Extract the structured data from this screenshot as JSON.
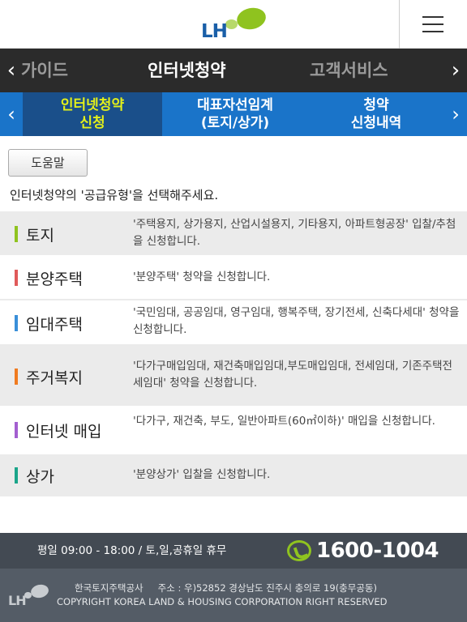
{
  "header": {
    "logo_text": "LH"
  },
  "topnav": {
    "prev": "가이드",
    "current": "인터넷청약",
    "next": "고객서비스",
    "arrow_left": "‹",
    "arrow_right": "›"
  },
  "subnav": {
    "tabs": [
      {
        "line1": "인터넷청약",
        "line2": "신청"
      },
      {
        "line1": "대표자선임계",
        "line2": "(토지/상가)"
      },
      {
        "line1": "청약",
        "line2": "신청내역"
      }
    ],
    "arrow_left": "‹",
    "arrow_right": "›"
  },
  "help_label": "도움말",
  "instruction": "인터넷청약의 '공급유형'을 선택해주세요.",
  "supply_types": [
    {
      "title": "토지",
      "desc": "'주택용지, 상가용지, 산업시설용지, 기타용지, 아파트형공장' 입찰/추첨을 신청합니다.",
      "color": "#8fc31f"
    },
    {
      "title": "분양주택",
      "desc": "'분양주택' 청약을 신청합니다.",
      "color": "#e05a5a"
    },
    {
      "title": "임대주택",
      "desc": "'국민임대, 공공임대, 영구임대, 행복주택, 장기전세, 신축다세대' 청약을 신청합니다.",
      "color": "#3a8fd9"
    },
    {
      "title": "주거복지",
      "desc": "'다가구매입임대, 재건축매입임대,부도매입임대, 전세임대, 기존주택전세임대' 청약을 신청합니다.",
      "color": "#f07b20"
    },
    {
      "title": "인터넷 매입",
      "desc": "'다가구, 재건축, 부도, 일반아파트(60㎡이하)' 매입을 신청합니다.",
      "color": "#a35fd0"
    },
    {
      "title": "상가",
      "desc": "'분양상가' 입찰을 신청합니다.",
      "color": "#1aa58a"
    }
  ],
  "footer": {
    "hours": "평일 09:00 - 18:00 / 토,일,공휴일 휴무",
    "phone": "1600-1004",
    "company": "한국토지주택공사",
    "address": "주소 : 우)52852   경상남도 진주시 충의로 19(충무공동)",
    "copyright": "COPYRIGHT KOREA LAND & HOUSING CORPORATION RIGHT RESERVED",
    "logo_text": "LH"
  }
}
